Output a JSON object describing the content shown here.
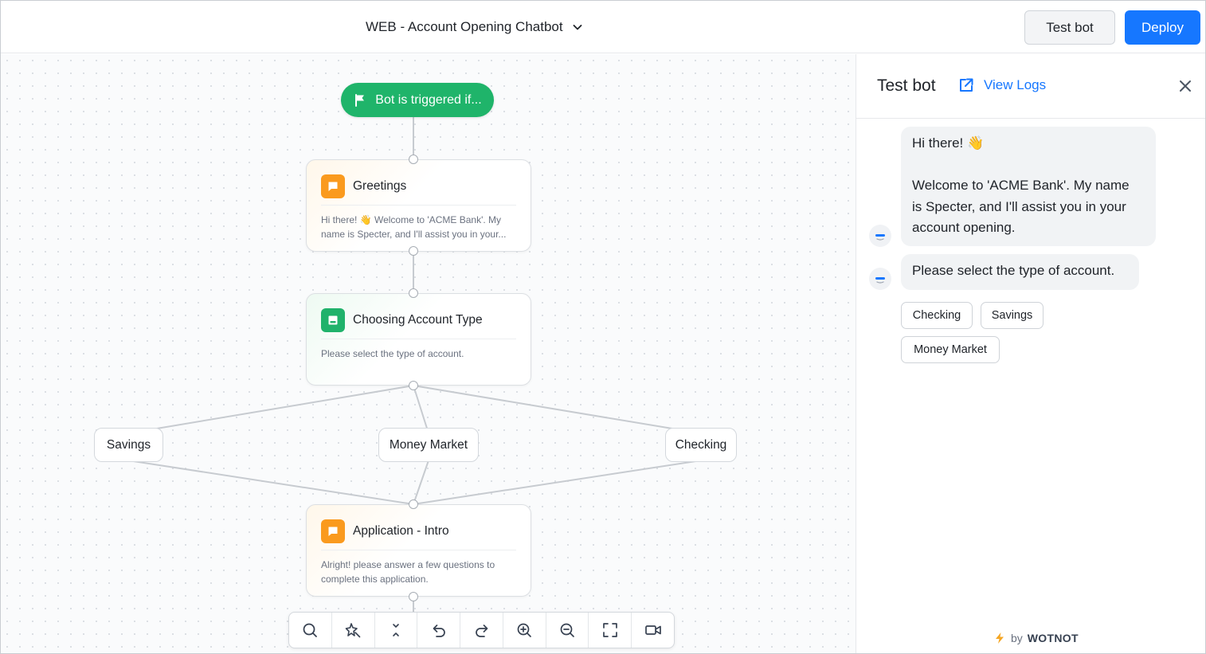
{
  "header": {
    "bot_name": "WEB - Account Opening Chatbot",
    "test_bot_label": "Test bot",
    "deploy_label": "Deploy"
  },
  "canvas": {
    "trigger_label": "Bot is triggered if...",
    "nodes": [
      {
        "title": "Greetings",
        "icon": "chat-bubble-icon",
        "color": "#fa9a1e",
        "body": "Hi there! 👋 Welcome to 'ACME Bank'. My name is Specter, and I'll assist you in your..."
      },
      {
        "title": "Choosing Account Type",
        "icon": "button-card-icon",
        "color": "#20b26b",
        "body": "Please select the type of account."
      },
      {
        "title": "Application - Intro",
        "icon": "chat-bubble-icon",
        "color": "#fa9a1e",
        "body": "Alright! please answer a few questions to complete this application."
      }
    ],
    "options": [
      "Savings",
      "Money Market",
      "Checking"
    ]
  },
  "toolbar": {
    "tools": [
      "search-icon",
      "auto-arrange-icon",
      "collapse-icon",
      "undo-icon",
      "redo-icon",
      "zoom-in-icon",
      "zoom-out-icon",
      "fullscreen-icon",
      "record-video-icon"
    ]
  },
  "panel": {
    "title": "Test bot",
    "view_logs": "View Logs",
    "messages": [
      {
        "lines": [
          "Hi there! 👋",
          "",
          "Welcome to 'ACME Bank'. My name",
          "is Specter, and I'll assist you in your",
          "account opening."
        ]
      },
      {
        "lines": [
          "Please select the type of account."
        ]
      }
    ],
    "choices": [
      "Checking",
      "Savings",
      "Money Market"
    ],
    "powered_by_prefix": "by",
    "powered_by_brand": "WOTNOT"
  },
  "colors": {
    "accent": "#1677ff",
    "trigger": "#1fb46a",
    "message_node": "#fa9a1e",
    "button_node": "#20b26b"
  }
}
